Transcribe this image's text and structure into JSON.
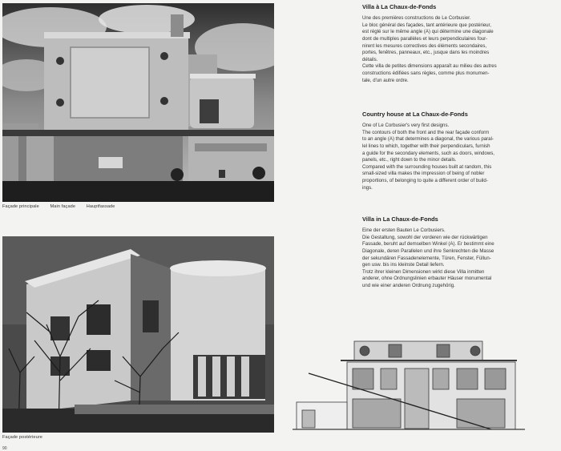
{
  "captions": {
    "main_facade": [
      "Façade principale",
      "Main façade",
      "Hauptfassade"
    ],
    "rear_facade": [
      "Façade postérieure"
    ]
  },
  "text_blocks": [
    {
      "heading": "Villa à La Chaux-de-Fonds",
      "lines": [
        "Une des premières constructions de Le Corbusier.",
        "Le bloc général des façades, tant antérieure que postérieur,",
        "est réglé sur le même angle (A) qui détermine une diagonale",
        "dont de multiples parallèles et leurs perpendiculaires four-",
        "nirent les mesures correctives des éléments secondaires,",
        "portes, fenêtres, panneaux, etc., jusque dans les moindres",
        "détails.",
        "Cette villa de petites dimensions apparaît au milieu des autres",
        "constructions édifiées sans règles, comme plus monumen-",
        "tale, d'un autre ordre."
      ]
    },
    {
      "heading": "Country house at La Chaux-de-Fonds",
      "lines": [
        "One of Le Corbusier's very first designs.",
        "The contours of both the front and the rear façade conform",
        "to an angle (A) that determines a diagonal, the various paral-",
        "lel lines to which, together with their perpendiculars, furnish",
        "a guide for the secondary elements, such as doors, windows,",
        "panels, etc., right down to the minor details.",
        "Compared with the surrounding houses built at random, this",
        "small-sized villa makes the impression of being of nobler",
        "proportions, of belonging to quite a different order of build-",
        "ings."
      ]
    },
    {
      "heading": "Villa in La Chaux-de-Fonds",
      "lines": [
        "Eine der ersten Bauten Le Corbusiers.",
        "Die Gestaltung, sowohl der vorderen wie der rückwärtigen",
        "Fassade, beruht auf demselben Winkel (A). Er bestimmt eine",
        "Diagonale, deren Parallelen und ihre Senkrechten die Masse",
        "der sekundären Fassadenelemente, Türen, Fenster, Füllun-",
        "gen usw. bis ins kleinste Detail liefern.",
        "Trotz ihrer kleinen Dimensionen wirkt diese Villa inmitten",
        "anderer, ohne Ordnungslinien erbauter Häuser monumental",
        "und wie einer anderen Ordnung zugehörig."
      ]
    }
  ],
  "page_number": "90"
}
